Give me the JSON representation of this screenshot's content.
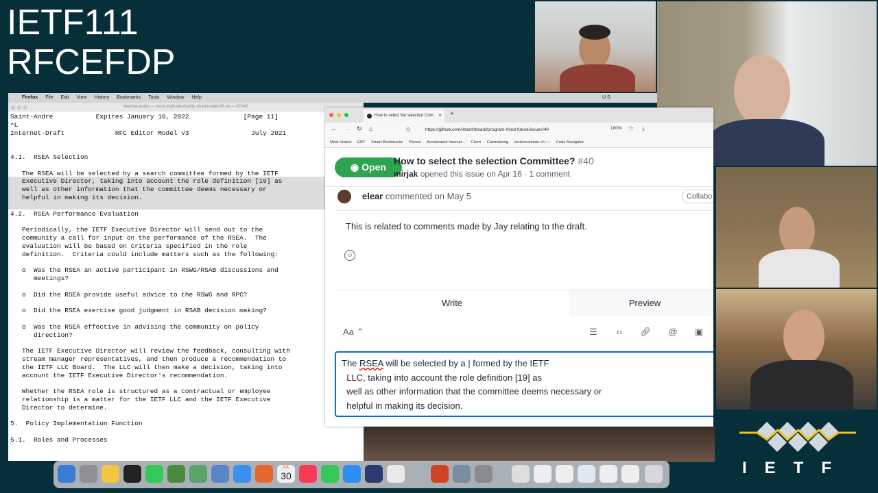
{
  "slide": {
    "title_line1": "IETF111",
    "title_line2": "RFCEFDP"
  },
  "firefox": {
    "menubar": [
      "Firefox",
      "File",
      "Edit",
      "View",
      "History",
      "Bookmarks",
      "Tools",
      "Window",
      "Help"
    ],
    "status_right": [
      "U.S."
    ],
    "window_title": "internet-drafts — more draft-iab-rfcefdp-rfced-model-00.txt — 87×42",
    "document_text": "Saint-Andre           Expires January 10, 2022              [Page 11]\n^L\nInternet-Draft             RFC Editor Model v3                July 2021\n\n\n4.1.  RSEA Selection\n\n   The RSEA will be selected by a search committee formed by the IETF\n   Executive Director, taking into account the role definition [19] as\n   well as other information that the committee deems necessary or\n   helpful in making its decision.\n\n4.2.  RSEA Performance Evaluation\n\n   Periodically, the IETF Executive Director will send out to the\n   community a call for input on the performance of the RSEA.  The\n   evaluation will be based on criteria specified in the role\n   definition.  Criteria could include matters such as the following:\n\n   o  Was the RSEA an active participant in RSWG/RSAB discussions and\n      meetings?\n\n   o  Did the RSEA provide useful advice to the RSWG and RPC?\n\n   o  Did the RSEA exercise good judgment in RSAB decision making?\n\n   o  Was the RSEA effective in advising the community on policy\n      direction?\n\n   The IETF Executive Director will review the feedback, consulting with\n   stream manager representatives, and then produce a recommendation to\n   the IETF LLC Board.  The LLC will then make a decision, taking into\n   account the IETF Executive Director's recommendation.\n\n   Whether the RSEA role is structured as a contractual or employee\n   relationship is a matter for the IETF LLC and the IETF Executive\n   Director to determine.\n\n5.  Policy Implementation Function\n\n5.1.  Roles and Processes"
  },
  "browser": {
    "tab_title": "How to select the selection Com",
    "url": "https://github.com/intarchboard/program-rfced-future/issues/40",
    "zoom": "180%",
    "bookmarks": [
      "Most Visited",
      "ERT",
      "Smart Bookmarks",
      "Places",
      "Accelerated Innovat...",
      "Cisco",
      "Calendaring",
      "meteocentrale.ch :...",
      "Code Navigator"
    ],
    "issue": {
      "status": "Open",
      "title": "How to select the selection Committee?",
      "number": "#40",
      "author": "mirjak",
      "meta": "opened this issue on Apr 16 · 1 comment"
    },
    "comment": {
      "author": "elear",
      "action": "commented on May 5",
      "role_badge": "Collabo",
      "body": "This is related to comments made by Jay relating to the draft."
    },
    "editor": {
      "tab_write": "Write",
      "tab_preview": "Preview",
      "text_size_label": "Aa",
      "line1_a": "The ",
      "line1_spell": "RSEA",
      "line1_b": " will be selected by a | formed by the IETF",
      "line2": "  LLC, taking into account the role definition [19] as",
      "line3": "  well as other information that the committee deems necessary or",
      "line4": "  helpful in making its decision."
    }
  },
  "dock": {
    "calendar_month": "JUL",
    "calendar_day": "30"
  },
  "logo": {
    "text": "IETF"
  },
  "colors": {
    "background": "#062f3a",
    "github_green": "#2da44e",
    "editor_focus": "#0969da"
  }
}
